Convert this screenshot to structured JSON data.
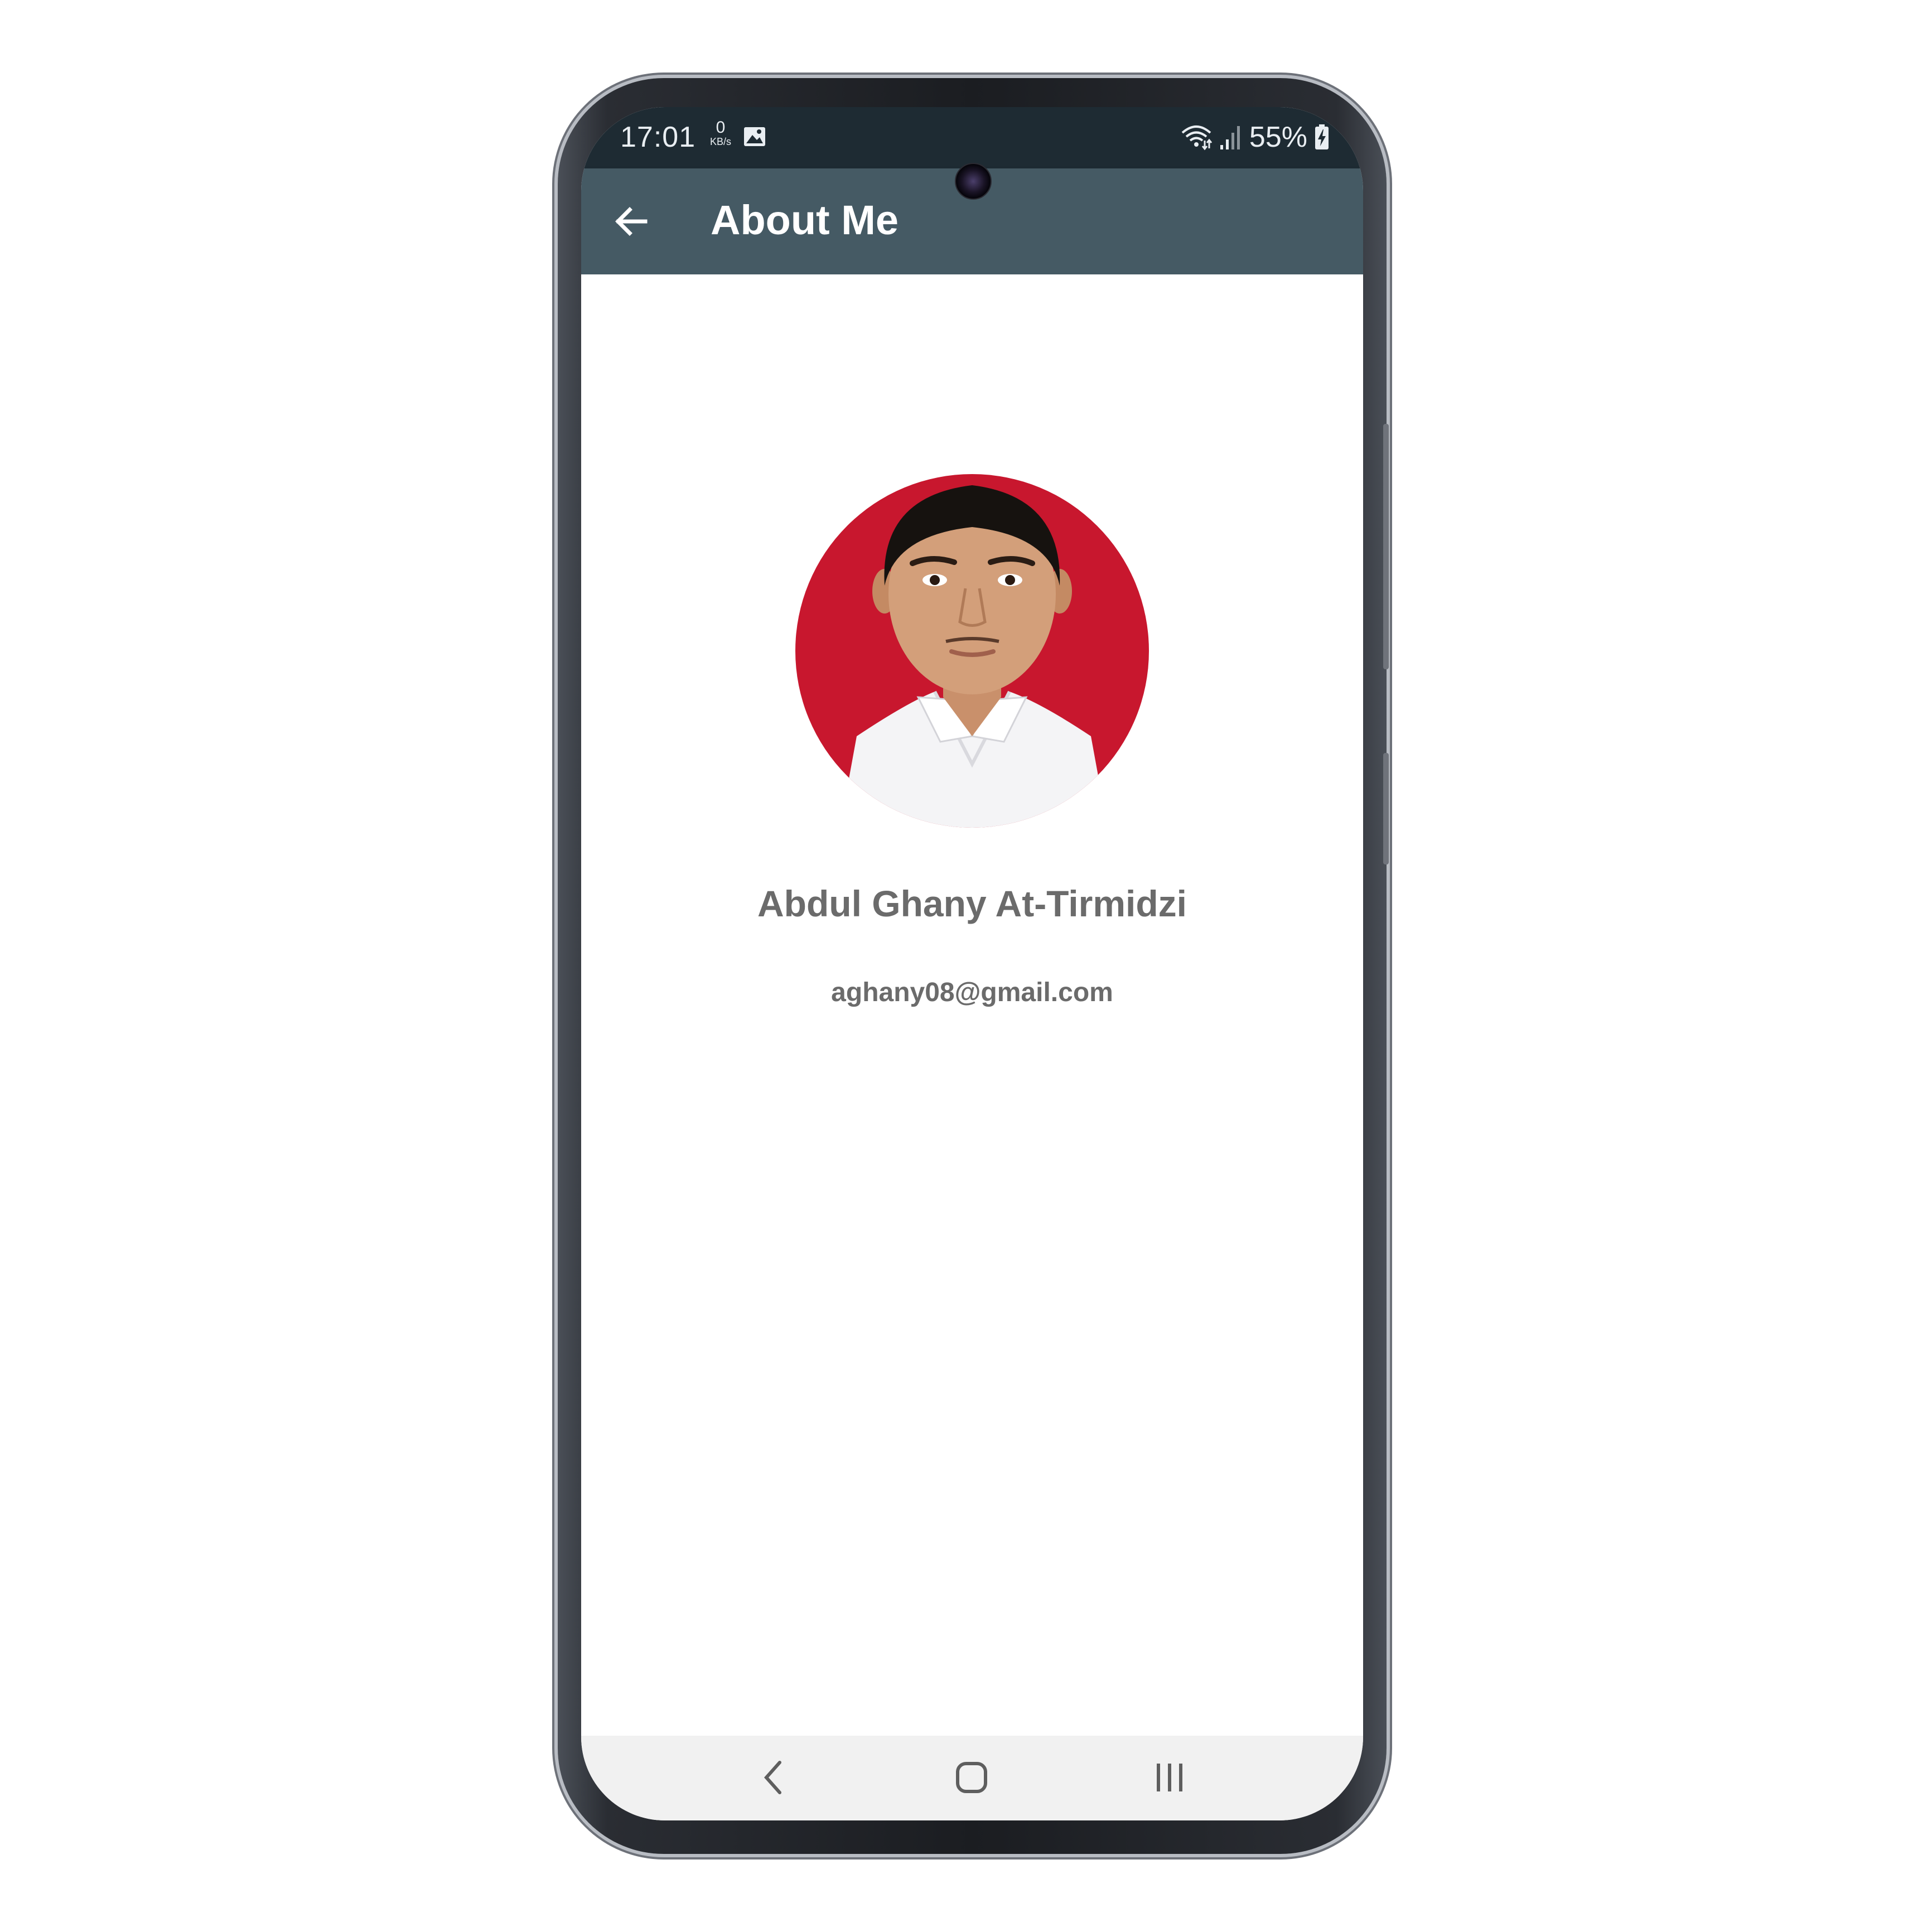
{
  "status_bar": {
    "time": "17:01",
    "network_speed_value": "0",
    "network_speed_unit": "KB/s",
    "battery_percent": "55%",
    "icons": [
      "image-icon",
      "wifi-icon",
      "signal-icon",
      "battery-charging-icon"
    ]
  },
  "app_bar": {
    "title": "About Me",
    "back_icon": "arrow-left-icon",
    "background_color": "#455a64"
  },
  "profile": {
    "name": "Abdul Ghany At-Tirmidzi",
    "email": "aghany08@gmail.com",
    "avatar_background_color": "#c8172e"
  },
  "nav_bar": {
    "buttons": [
      "back-nav-icon",
      "home-nav-icon",
      "recents-nav-icon"
    ]
  }
}
